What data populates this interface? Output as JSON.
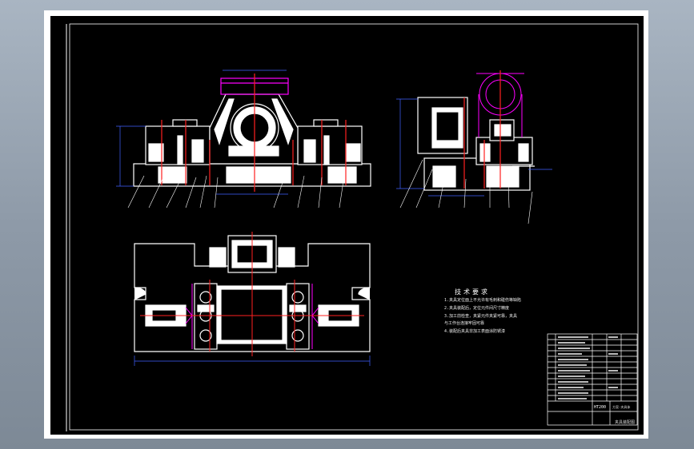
{
  "technical_requirements": {
    "title": "技术要求",
    "items": [
      "1.夹具定位面上不允许有毛刺和碰伤等缺陷",
      "2.夹具装配后，定位元件间尺寸精度",
      "3.加工前检查，夹紧元件夹紧可靠，夹具",
      "  与工作台连接牢固可靠",
      "4.装配后夹具非加工表面涂防锈漆"
    ]
  },
  "title_block": {
    "drawing_code": "HT200",
    "scheme_text": "方案-夹具体",
    "drawing_name": "夹具装配图"
  },
  "colors": {
    "background": "#000000",
    "outline": "#ffffff",
    "accent_magenta": "#ff00ff",
    "accent_red": "#ff2020",
    "accent_cyan": "#00ffff",
    "accent_blue": "#4060ff",
    "frame": "#ffffff"
  }
}
